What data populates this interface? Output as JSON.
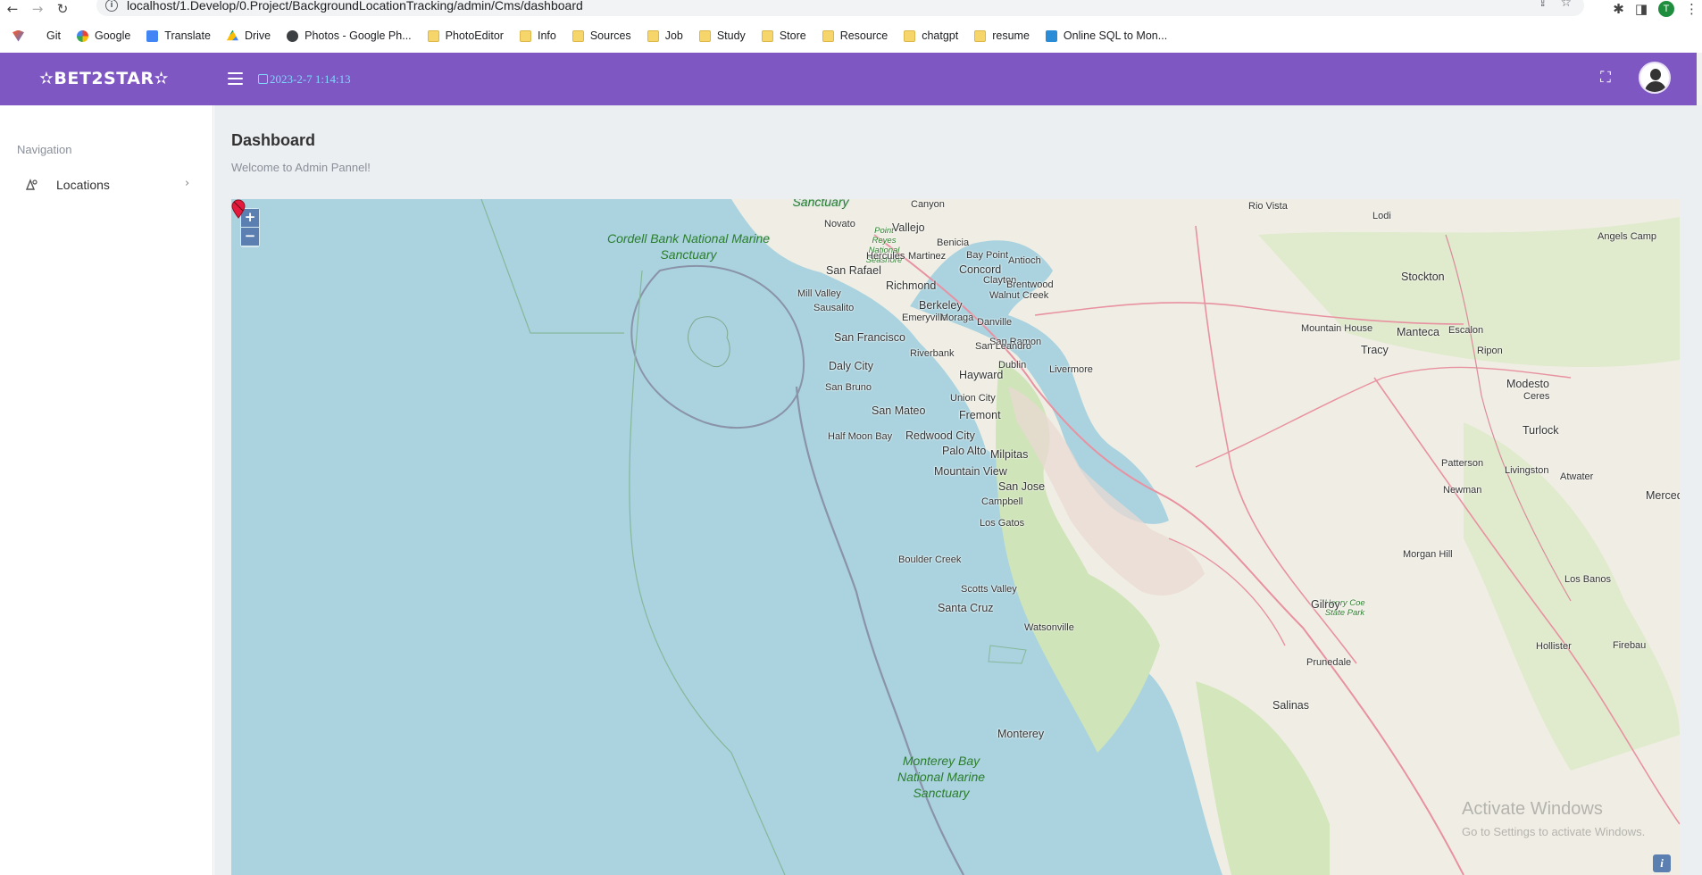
{
  "browser": {
    "url": "localhost/1.Develop/0.Project/BackgroundLocationTracking/admin/Cms/dashboard",
    "profile_initial": "T",
    "bookmarks": [
      {
        "label": "Git",
        "icon": "git-icon"
      },
      {
        "label": "Google",
        "icon": "google-icon"
      },
      {
        "label": "Translate",
        "icon": "translate-icon"
      },
      {
        "label": "Drive",
        "icon": "drive-icon"
      },
      {
        "label": "Photos - Google Ph...",
        "icon": "globe-icon"
      },
      {
        "label": "PhotoEditor",
        "icon": "folder-icon"
      },
      {
        "label": "Info",
        "icon": "folder-icon"
      },
      {
        "label": "Sources",
        "icon": "folder-icon"
      },
      {
        "label": "Job",
        "icon": "folder-icon"
      },
      {
        "label": "Study",
        "icon": "folder-icon"
      },
      {
        "label": "Store",
        "icon": "folder-icon"
      },
      {
        "label": "Resource",
        "icon": "folder-icon"
      },
      {
        "label": "chatgpt",
        "icon": "folder-icon"
      },
      {
        "label": "resume",
        "icon": "folder-icon"
      },
      {
        "label": "Online SQL to Mon...",
        "icon": "sql-icon"
      }
    ]
  },
  "header": {
    "brand": "✫BET2STAR✫",
    "datetime": "2023-2-7  1:14:13",
    "accent": "#7e57c2"
  },
  "sidebar": {
    "title": "Navigation",
    "items": [
      {
        "label": "Locations",
        "icon": "map-pin-icon"
      }
    ]
  },
  "main": {
    "title": "Dashboard",
    "subtitle": "Welcome to Admin Pannel!"
  },
  "map": {
    "zoom_in": "+",
    "zoom_out": "−",
    "attribution": "i",
    "marker_color": "#e4193b",
    "sanctuaries": [
      {
        "text": "Cordell Bank National Marine Sanctuary"
      },
      {
        "text": "Monterey Bay National Marine Sanctuary"
      },
      {
        "text": "Sanctuary"
      },
      {
        "text": "Point Reyes National Seashore"
      },
      {
        "text": "Henry Coe State Park"
      }
    ],
    "places": [
      "Canyon",
      "Rio Vista",
      "Lodi",
      "Novato",
      "Vallejo",
      "Benicia",
      "Angels Camp",
      "Hercules",
      "Martinez",
      "Bay Point",
      "Antioch",
      "San Rafael",
      "Concord",
      "Stockton",
      "Richmond",
      "Clayton",
      "Brentwood",
      "Mill Valley",
      "Walnut Creek",
      "Berkeley",
      "Sausalito",
      "Emeryville",
      "Moraga",
      "Danville",
      "Mountain House",
      "Manteca",
      "Escalon",
      "San Francisco",
      "San Ramon",
      "Tracy",
      "Ripon",
      "Riverbank",
      "San Leandro",
      "Daly City",
      "Dublin",
      "Livermore",
      "Hayward",
      "Modesto",
      "San Bruno",
      "Union City",
      "Ceres",
      "San Mateo",
      "Fremont",
      "Redwood City",
      "Turlock",
      "Half Moon Bay",
      "Palo Alto",
      "Milpitas",
      "Patterson",
      "Mountain View",
      "San Jose",
      "Livingston",
      "Campbell",
      "Atwater",
      "Newman",
      "Merced",
      "Los Gatos",
      "Boulder Creek",
      "Morgan Hill",
      "Scotts Valley",
      "Los Banos",
      "Santa Cruz",
      "Gilroy",
      "Watsonville",
      "Hollister",
      "Firebau",
      "Prunedale",
      "Salinas",
      "Monterey"
    ]
  },
  "watermark": {
    "line1": "Activate Windows",
    "line2": "Go to Settings to activate Windows."
  }
}
